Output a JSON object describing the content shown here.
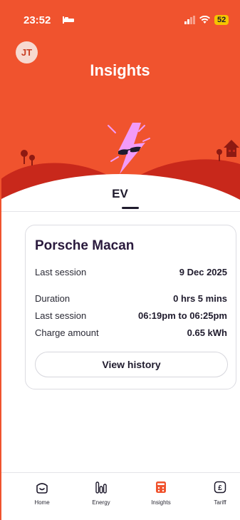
{
  "status": {
    "time": "23:52",
    "battery": "52"
  },
  "header": {
    "avatar_initials": "JT",
    "title": "Insights"
  },
  "tab": {
    "label": "EV"
  },
  "card": {
    "vehicle": "Porsche Macan",
    "rows": [
      {
        "label": "Last session",
        "value": "9 Dec 2025"
      },
      {
        "label": "Duration",
        "value": "0 hrs 5 mins"
      },
      {
        "label": "Last session",
        "value": "06:19pm to 06:25pm"
      },
      {
        "label": "Charge amount",
        "value": "0.65 kWh"
      }
    ],
    "button": "View history"
  },
  "nav": [
    {
      "label": "Home",
      "icon": "home-icon"
    },
    {
      "label": "Energy",
      "icon": "energy-icon"
    },
    {
      "label": "Insights",
      "icon": "insights-icon"
    },
    {
      "label": "Tariff",
      "icon": "tariff-icon"
    }
  ],
  "colors": {
    "brand": "#f0532e",
    "active_nav": "#f0532e",
    "text_dark": "#1f1b2d",
    "mascot": "#f29bf7"
  }
}
